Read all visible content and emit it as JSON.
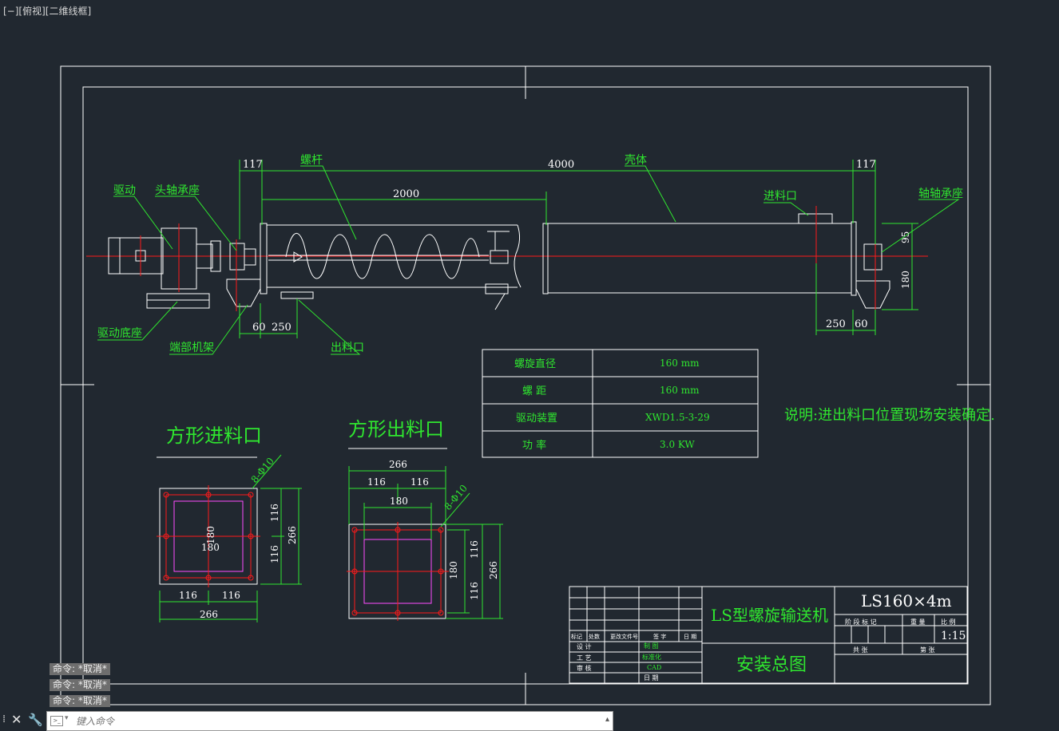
{
  "viewport": {
    "label": "[−][俯视][二维线框]"
  },
  "drawing": {
    "overall_labels": {
      "left_gap": "117",
      "total_length": "4000",
      "right_gap": "117",
      "half_length": "2000"
    },
    "callouts": {
      "screw": "螺杆",
      "shell": "壳体",
      "drive": "驱动",
      "head_bearing": "头轴承座",
      "inlet": "进料口",
      "tail_bearing": "轴轴承座",
      "drive_base": "驱动底座",
      "end_frame": "端部机架",
      "outlet": "出料口"
    },
    "dims": {
      "d60_left": "60",
      "d250_left": "250",
      "d250_right": "250",
      "d60_right": "60",
      "d95": "95",
      "d180": "180"
    },
    "spec_table": [
      {
        "label": "螺旋直径",
        "value": "160 mm"
      },
      {
        "label": "螺 距",
        "value": "160 mm"
      },
      {
        "label": "驱动装置",
        "value": "XWD1.5-3-29"
      },
      {
        "label": "功 率",
        "value": "3.0 KW"
      }
    ],
    "note": "说明:进出料口位置现场安装确定.",
    "square_inlet": {
      "title": "方形进料口",
      "hole_note": "8-Φ10",
      "dim_bottom_a": "116",
      "dim_bottom_b": "116",
      "dim_total": "266",
      "dim_right_a": "116",
      "dim_right_b": "116",
      "dim_right_total": "266",
      "dim_inner_h": "180",
      "dim_inner_w": "180"
    },
    "square_outlet": {
      "title": "方形出料口",
      "hole_note": "8-Φ10",
      "dim_top_total": "266",
      "dim_top_a": "116",
      "dim_top_b": "116",
      "dim_inner": "180",
      "dim_right_a": "116",
      "dim_right_b": "116",
      "dim_right_total": "266",
      "dim_inner_v": "180"
    },
    "title_block": {
      "name": "LS型螺旋输送机",
      "drawing_title": "安装总图",
      "model": "LS160×4m",
      "scale": "1:15",
      "scale_headers": [
        "阶 段 标 记",
        "重 量",
        "比 例"
      ],
      "sheet_labels": [
        "共 张",
        "第 张"
      ],
      "rev_headers": [
        "标记",
        "处数",
        "更改文件号",
        "签 字",
        "日 期"
      ],
      "roles": [
        "设 计",
        "工 艺",
        "审 核"
      ],
      "sign_fields": [
        "制 图",
        "标准化",
        "CAD",
        "日 期"
      ]
    }
  },
  "command_history": [
    "命令: *取消*",
    "命令: *取消*",
    "命令: *取消*"
  ],
  "command_line": {
    "placeholder": "键入命令"
  },
  "colors": {
    "background": "#212830",
    "green": "#2fe62f",
    "red": "#ff1a1a",
    "white": "#ffffff",
    "magenta": "#ff4dff"
  }
}
